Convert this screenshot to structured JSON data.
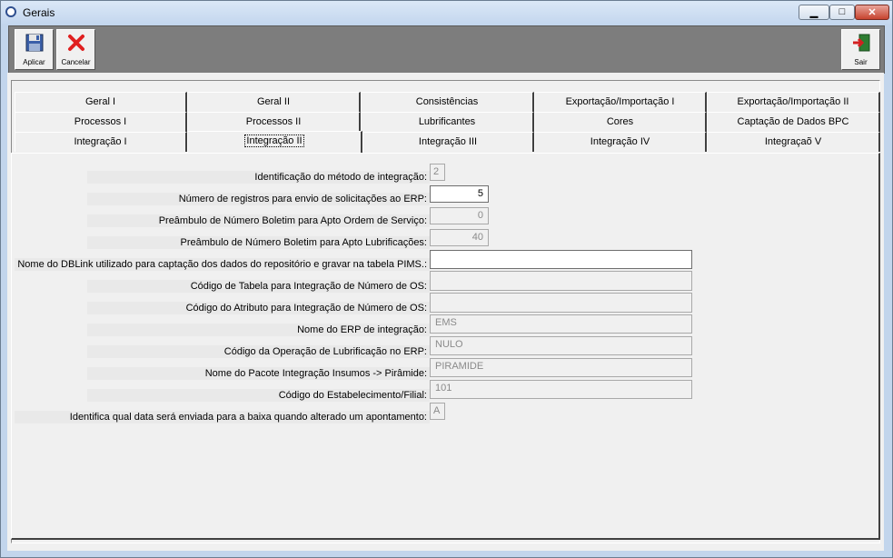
{
  "window": {
    "title": "Gerais"
  },
  "toolbar": {
    "apply_label": "Aplicar",
    "cancel_label": "Cancelar",
    "exit_label": "Sair"
  },
  "tabs": {
    "row1": [
      "Geral I",
      "Geral II",
      "Consistências",
      "Exportação/Importação I",
      "Exportação/Importação II"
    ],
    "row2": [
      "Processos I",
      "Processos II",
      "Lubrificantes",
      "Cores",
      "Captação de Dados BPC"
    ],
    "row3": [
      "Integração I",
      "Integração II",
      "Integração III",
      "Integração IV",
      "Integraçaõ V"
    ],
    "active": "Integração II"
  },
  "form": {
    "fields": [
      {
        "label": "Identificação do método de integração:",
        "value": "2"
      },
      {
        "label": "Número de registros para envio de solicitações ao ERP:",
        "value": "5"
      },
      {
        "label": "Preâmbulo de Número Boletim para Apto Ordem de Serviço:",
        "value": "0"
      },
      {
        "label": "Preâmbulo de Número Boletim para Apto Lubrificações:",
        "value": "40"
      },
      {
        "label": "Nome do DBLink utilizado para captação dos dados do repositório e gravar na tabela PIMS.:",
        "value": ""
      },
      {
        "label": "Código de Tabela para Integração de Número de OS:",
        "value": ""
      },
      {
        "label": "Código do Atributo para Integração de Número de OS:",
        "value": ""
      },
      {
        "label": "Nome do ERP de integração:",
        "value": "EMS"
      },
      {
        "label": "Código da Operação de Lubrificação no ERP:",
        "value": "NULO"
      },
      {
        "label": "Nome do Pacote Integração Insumos -> Pirâmide:",
        "value": "PIRAMIDE"
      },
      {
        "label": "Código do Estabelecimento/Filial:",
        "value": "101"
      },
      {
        "label": "Identifica qual data será enviada para a baixa quando alterado um apontamento:",
        "value": "A"
      }
    ]
  }
}
